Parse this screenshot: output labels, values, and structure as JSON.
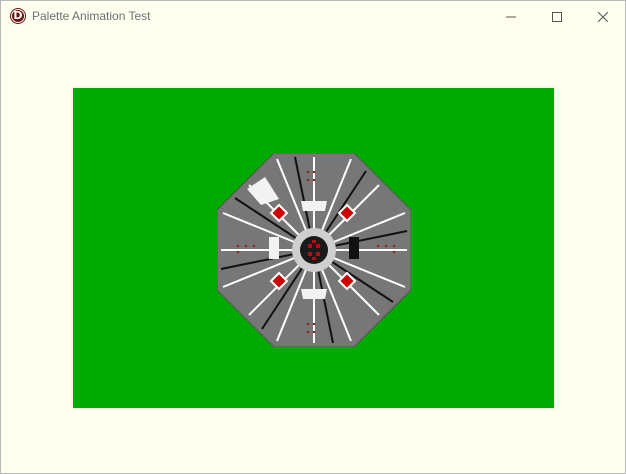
{
  "window": {
    "title": "Palette Animation Test",
    "icon_letter": "D"
  },
  "controls": {
    "minimize": "minimize-icon",
    "maximize": "maximize-icon",
    "close": "close-icon"
  },
  "colors": {
    "window_bg": "#fffff0",
    "canvas_bg": "#00aa00",
    "sprite_gray": "#777777",
    "sprite_red": "#cc0000",
    "icon_red": "#6a1410"
  }
}
